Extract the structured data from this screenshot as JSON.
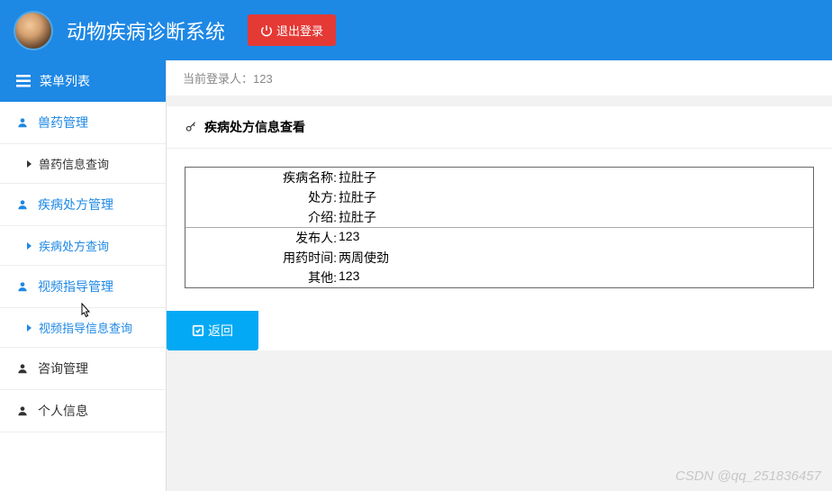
{
  "header": {
    "title": "动物疾病诊断系统",
    "logout": "退出登录"
  },
  "sidebar": {
    "title": "菜单列表",
    "groups": [
      {
        "label": "兽药管理",
        "accent": true,
        "icon": "user",
        "children": [
          {
            "label": "兽药信息查询",
            "accent": false
          }
        ]
      },
      {
        "label": "疾病处方管理",
        "accent": true,
        "icon": "user",
        "children": [
          {
            "label": "疾病处方查询",
            "accent": true
          }
        ]
      },
      {
        "label": "视频指导管理",
        "accent": true,
        "icon": "user",
        "children": [
          {
            "label": "视频指导信息查询",
            "accent": true
          }
        ]
      },
      {
        "label": "咨询管理",
        "accent": false,
        "icon": "user",
        "children": []
      },
      {
        "label": "个人信息",
        "accent": false,
        "icon": "user",
        "children": []
      }
    ]
  },
  "main": {
    "login_prefix": "当前登录人：",
    "login_user": "123",
    "panel_title": "疾病处方信息查看",
    "details": [
      {
        "label": "疾病名称:",
        "value": "拉肚子"
      },
      {
        "label": "处方:",
        "value": "拉肚子"
      },
      {
        "label": "介绍:",
        "value": "拉肚子"
      },
      {
        "label": "发布人:",
        "value": "123"
      },
      {
        "label": "用药时间:",
        "value": "两周使劲"
      },
      {
        "label": "其他:",
        "value": "123"
      }
    ],
    "back_btn": "返回"
  },
  "watermark": "CSDN @qq_251836457"
}
